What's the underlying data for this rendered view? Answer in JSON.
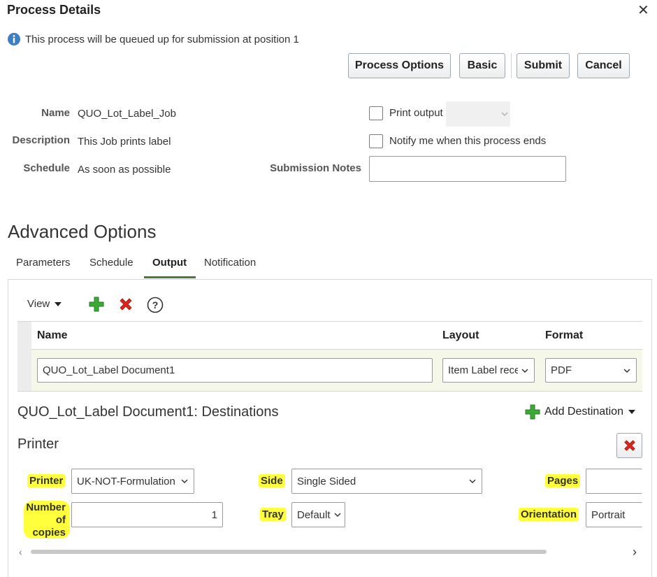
{
  "dialog": {
    "title": "Process Details",
    "close_symbol": "✕",
    "info_message": "This process will be queued up for submission at position 1"
  },
  "toolbar": {
    "process_options": "Process Options",
    "basic": "Basic",
    "submit": "Submit",
    "cancel": "Cancel"
  },
  "details": {
    "name_label": "Name",
    "name_value": "QUO_Lot_Label_Job",
    "description_label": "Description",
    "description_value": "This Job prints label",
    "schedule_label": "Schedule",
    "schedule_value": "As soon as possible",
    "print_output_label": "Print output",
    "notify_label": "Notify me when this process ends",
    "submission_notes_label": "Submission Notes",
    "submission_notes_value": ""
  },
  "advanced": {
    "heading": "Advanced Options",
    "tabs": [
      {
        "label": "Parameters",
        "active": false
      },
      {
        "label": "Schedule",
        "active": false
      },
      {
        "label": "Output",
        "active": true
      },
      {
        "label": "Notification",
        "active": false
      }
    ]
  },
  "output": {
    "view_label": "View",
    "columns": [
      "Name",
      "Layout",
      "Format"
    ],
    "row": {
      "name": "QUO_Lot_Label Document1",
      "layout": "Item Label rece",
      "format": "PDF"
    }
  },
  "destinations": {
    "heading": "QUO_Lot_Label Document1: Destinations",
    "add_destination": "Add Destination",
    "printer_section": "Printer",
    "printer_label": "Printer",
    "printer_value": "UK-NOT-Formulation",
    "copies_label_line1": "Number",
    "copies_label_line2": "of",
    "copies_label_line3": "copies",
    "copies_value": "1",
    "side_label": "Side",
    "side_value": "Single Sided",
    "tray_label": "Tray",
    "tray_value": "Default",
    "pages_label": "Pages",
    "pages_value": "",
    "orientation_label": "Orientation",
    "orientation_value": "Portrait"
  },
  "colors": {
    "highlight": "#ffff3b",
    "tab_underline": "#4a7a3c",
    "add_icon": "#3aaa35",
    "delete_icon": "#d9251c",
    "info_icon": "#3c7fc4",
    "row_bg": "#f5f8e8"
  },
  "icons": [
    "info-icon",
    "close-icon",
    "add-icon",
    "delete-icon",
    "help-icon",
    "chevron-down-icon",
    "caret-down-icon"
  ]
}
